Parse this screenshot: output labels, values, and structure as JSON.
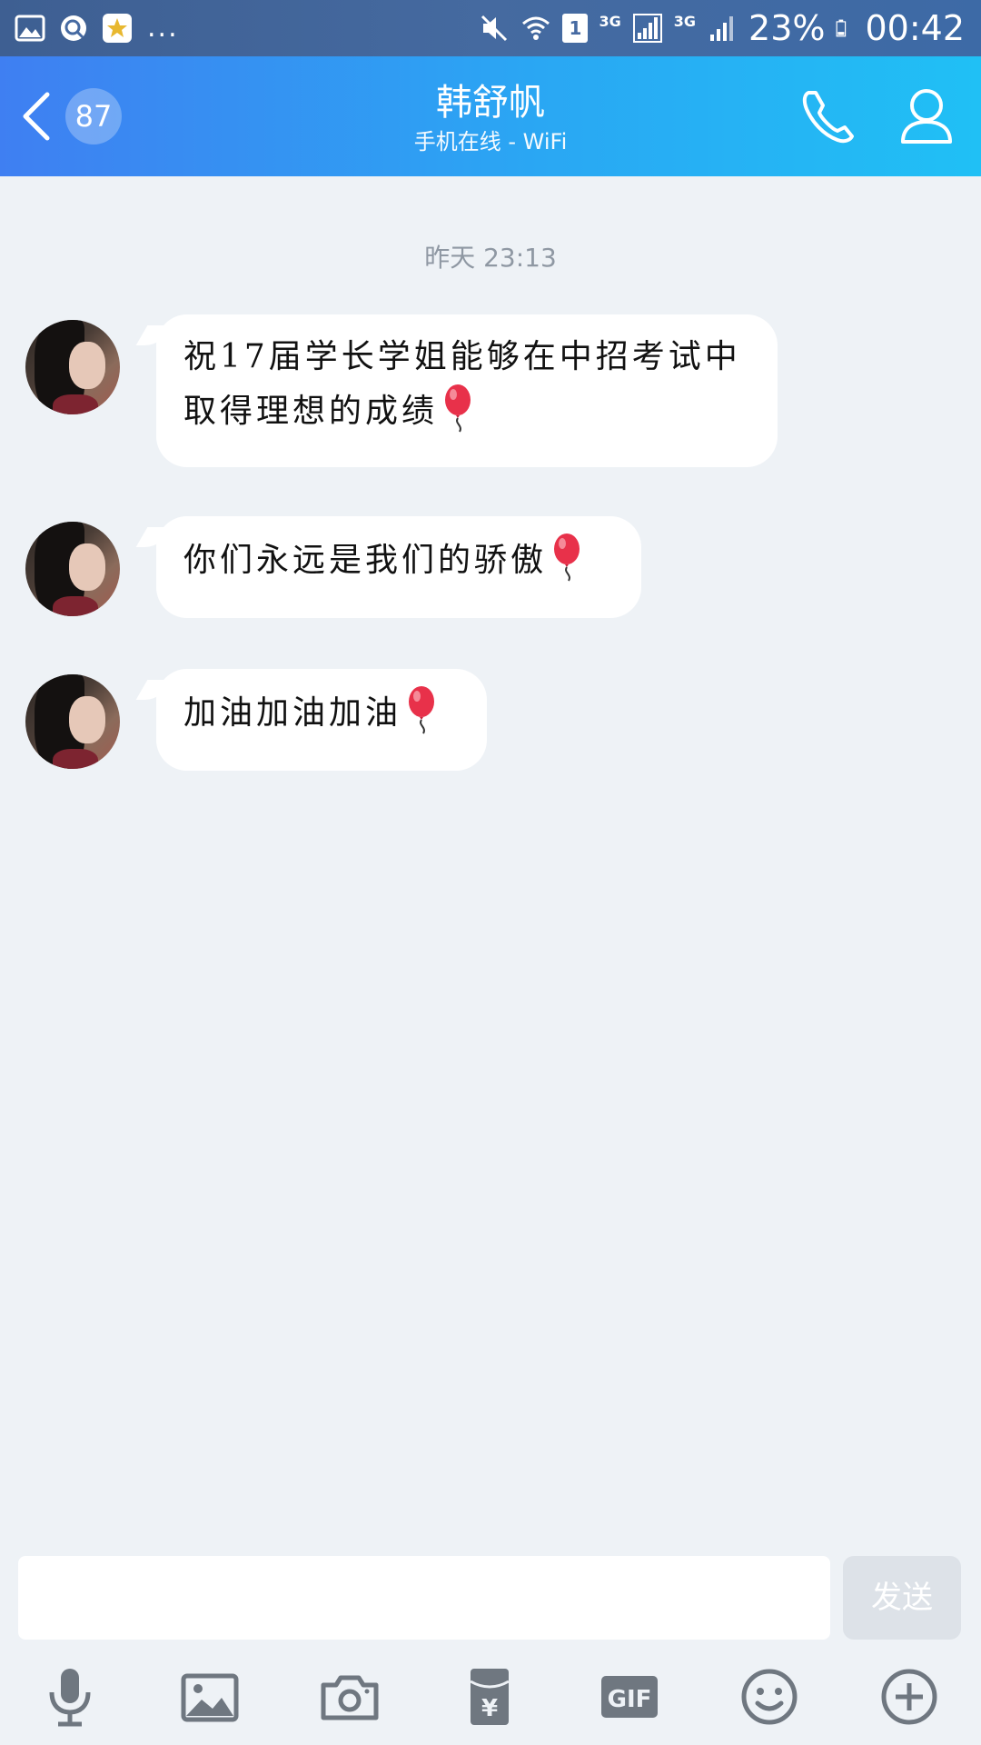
{
  "status_bar": {
    "dots": "...",
    "network_1": "3G",
    "network_2": "3G",
    "sim": "1",
    "battery": "23%",
    "time": "00:42"
  },
  "header": {
    "unread_count": "87",
    "title": "韩舒帆",
    "subtitle": "手机在线 - WiFi"
  },
  "chat": {
    "timestamp": "昨天 23:13",
    "messages": [
      {
        "text_line1": "祝17届学长学姐能够在中招考试中",
        "text_line2": "取得理想的成绩",
        "emoji": "balloon"
      },
      {
        "text": "你们永远是我们的骄傲",
        "emoji": "balloon"
      },
      {
        "text": "加油加油加油",
        "emoji": "balloon"
      }
    ]
  },
  "composer": {
    "input_value": "",
    "send_label": "发送"
  },
  "toolbar": {
    "icons": [
      "mic-icon",
      "image-icon",
      "camera-icon",
      "red-packet-icon",
      "gif-icon",
      "emoji-icon",
      "plus-icon"
    ],
    "gif_label": "GIF",
    "red_packet_symbol": "¥"
  },
  "colors": {
    "header_start": "#3f7ff2",
    "header_end": "#20c0f5",
    "chat_background": "#eef2f6",
    "toolbar_icon": "#6f7780"
  }
}
